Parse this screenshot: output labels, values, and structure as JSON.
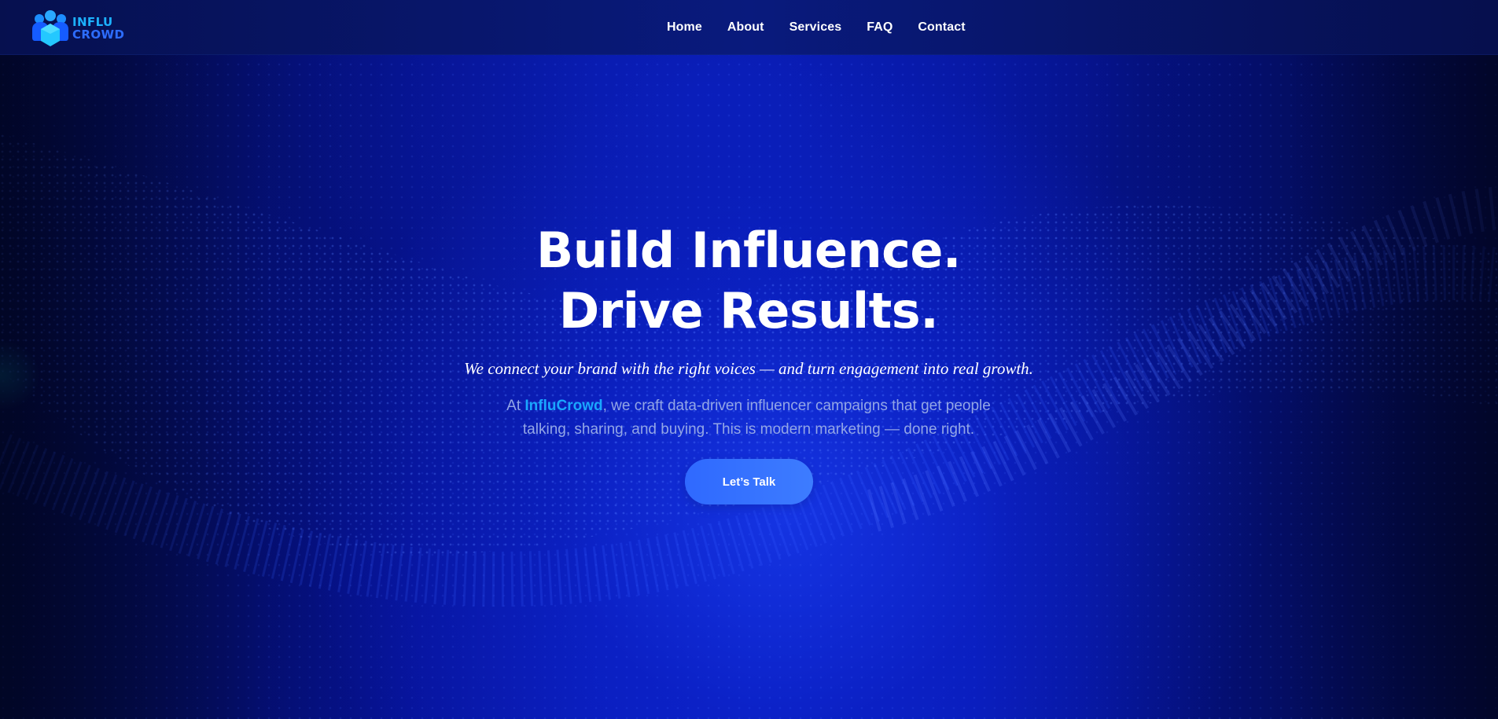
{
  "brand": {
    "name_line_1": "INFLU",
    "name_line_2": "CROWD",
    "logo_icon": "people-group-icon",
    "primary_color": "#1cb1ff",
    "secondary_color": "#2d6dff"
  },
  "navigation": {
    "items": [
      {
        "label": "Home"
      },
      {
        "label": "About"
      },
      {
        "label": "Services"
      },
      {
        "label": "FAQ"
      },
      {
        "label": "Contact"
      }
    ]
  },
  "hero": {
    "headline_line_1": "Build Influence.",
    "headline_line_2": "Drive Results.",
    "tagline": "We connect your brand with the right voices — and turn engagement into real growth.",
    "description_prefix": "At",
    "description_brand": "InfluCrowd",
    "description_rest": ", we craft data-driven influencer campaigns that get people talking, sharing, and buying. This is modern marketing — done right.",
    "cta_label": "Let’s Talk"
  },
  "colors": {
    "background": "#0a20c4",
    "text_primary": "#ffffff",
    "text_muted": "#93a6e6",
    "brand_highlight": "#1aa7ff",
    "cta_background": "#3270ff"
  }
}
